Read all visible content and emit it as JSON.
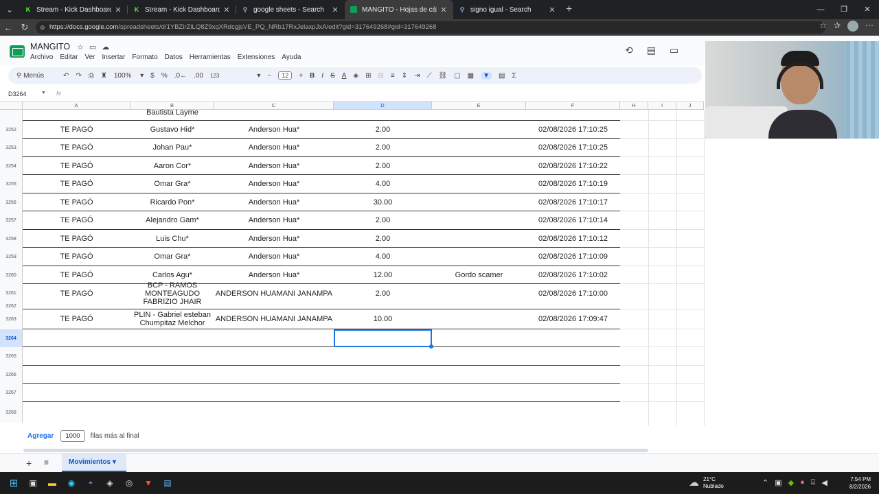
{
  "browser": {
    "tabs": [
      {
        "title": "Stream - Kick Dashboard",
        "icon": "kick-icon",
        "color": "#53fc18",
        "active": false
      },
      {
        "title": "Stream - Kick Dashboard",
        "icon": "kick-icon",
        "color": "#53fc18",
        "active": false
      },
      {
        "title": "google sheets - Search",
        "icon": "search-icon",
        "color": "#8ab4f8",
        "active": false
      },
      {
        "title": "MANGITO - Hojas de cálculo de Go",
        "icon": "sheets-icon",
        "color": "#0f9d58",
        "active": true
      },
      {
        "title": "signo igual - Search",
        "icon": "search-icon",
        "color": "#8ab4f8",
        "active": false
      }
    ],
    "url_prefix": "https://docs.google.com",
    "url_rest": "/spreadsheets/d/1YBZirZlLQ8Z9xqXRdcgjsVE_PQ_NRb17RxJelaxpJxA/edit?gid=317649268#gid=317649268"
  },
  "sheet": {
    "doc_title": "MANGITO",
    "menus": [
      "Archivo",
      "Editar",
      "Ver",
      "Insertar",
      "Formato",
      "Datos",
      "Herramientas",
      "Extensiones",
      "Ayuda"
    ],
    "toolbar": {
      "search": "Menús",
      "zoom": "100%",
      "currency": "$",
      "percent": "%",
      "dec_less": ".0←",
      "dec_more": ".00",
      "number_format": "123",
      "font_size": "12",
      "bold": "B",
      "italic": "I",
      "strike": "S",
      "text_color": "A"
    },
    "name_box": "D3264",
    "fx": "fx",
    "columns": [
      "A",
      "B",
      "C",
      "D",
      "E",
      "F",
      "H",
      "I",
      "J"
    ],
    "partial_row": {
      "b": "Bautista Layme"
    },
    "rows": [
      {
        "num": "3252",
        "a": "TE PAGÓ",
        "b": "Gustavo Hid*",
        "c": "Anderson Hua*",
        "d": "2.00",
        "e": "",
        "f": "02/08/2026 17:10:25"
      },
      {
        "num": "3253",
        "a": "TE PAGÓ",
        "b": "Johan Pau*",
        "c": "Anderson Hua*",
        "d": "2.00",
        "e": "",
        "f": "02/08/2026 17:10:25"
      },
      {
        "num": "3254",
        "a": "TE PAGÓ",
        "b": "Aaron Cor*",
        "c": "Anderson Hua*",
        "d": "2.00",
        "e": "",
        "f": "02/08/2026 17:10:22"
      },
      {
        "num": "3255",
        "a": "TE PAGÓ",
        "b": "Omar Gra*",
        "c": "Anderson Hua*",
        "d": "4.00",
        "e": "",
        "f": "02/08/2026 17:10:19"
      },
      {
        "num": "3256",
        "a": "TE PAGÓ",
        "b": "Ricardo Pon*",
        "c": "Anderson Hua*",
        "d": "30.00",
        "e": "",
        "f": "02/08/2026 17:10:17"
      },
      {
        "num": "3257",
        "a": "TE PAGÓ",
        "b": "Alejandro Gam*",
        "c": "Anderson Hua*",
        "d": "2.00",
        "e": "",
        "f": "02/08/2026 17:10:14"
      },
      {
        "num": "3258",
        "a": "TE PAGÓ",
        "b": "Luis Chu*",
        "c": "Anderson Hua*",
        "d": "2.00",
        "e": "",
        "f": "02/08/2026 17:10:12"
      },
      {
        "num": "3259",
        "a": "TE PAGÓ",
        "b": "Omar Gra*",
        "c": "Anderson Hua*",
        "d": "4.00",
        "e": "",
        "f": "02/08/2026 17:10:09"
      },
      {
        "num": "3260",
        "a": "TE PAGÓ",
        "b": "Carlos Agu*",
        "c": "Anderson Hua*",
        "d": "12.00",
        "e": "Gordo scamer",
        "f": "02/08/2026 17:10:02"
      },
      {
        "num": "3261",
        "a": "TE PAGÓ",
        "b": "BCP - RAMOS MONTEAGUDO FABRIZIO JHAIR",
        "c": "ANDERSON HUAMANI JANAMPA",
        "d": "2.00",
        "e": "",
        "f": "02/08/2026 17:10:00"
      },
      {
        "num": "3263",
        "a": "TE PAGÓ",
        "b": "PLIN - Gabriel esteban Chumpitaz Melchor",
        "c": "ANDERSON HUAMANI JANAMPA",
        "d": "10.00",
        "e": "",
        "f": "02/08/2026 17:09:47"
      }
    ],
    "row_3262": "3262",
    "empty_rows": [
      "3264",
      "3265",
      "3266",
      "3267",
      "3268"
    ],
    "add_rows": {
      "button": "Agregar",
      "count": "1000",
      "suffix": "filas más al final"
    },
    "sheet_tab": "Movimientos"
  },
  "taskbar": {
    "weather_temp": "21°C",
    "weather_desc": "Nublado",
    "time": "7:54 PM",
    "date": "8/2/2026"
  }
}
